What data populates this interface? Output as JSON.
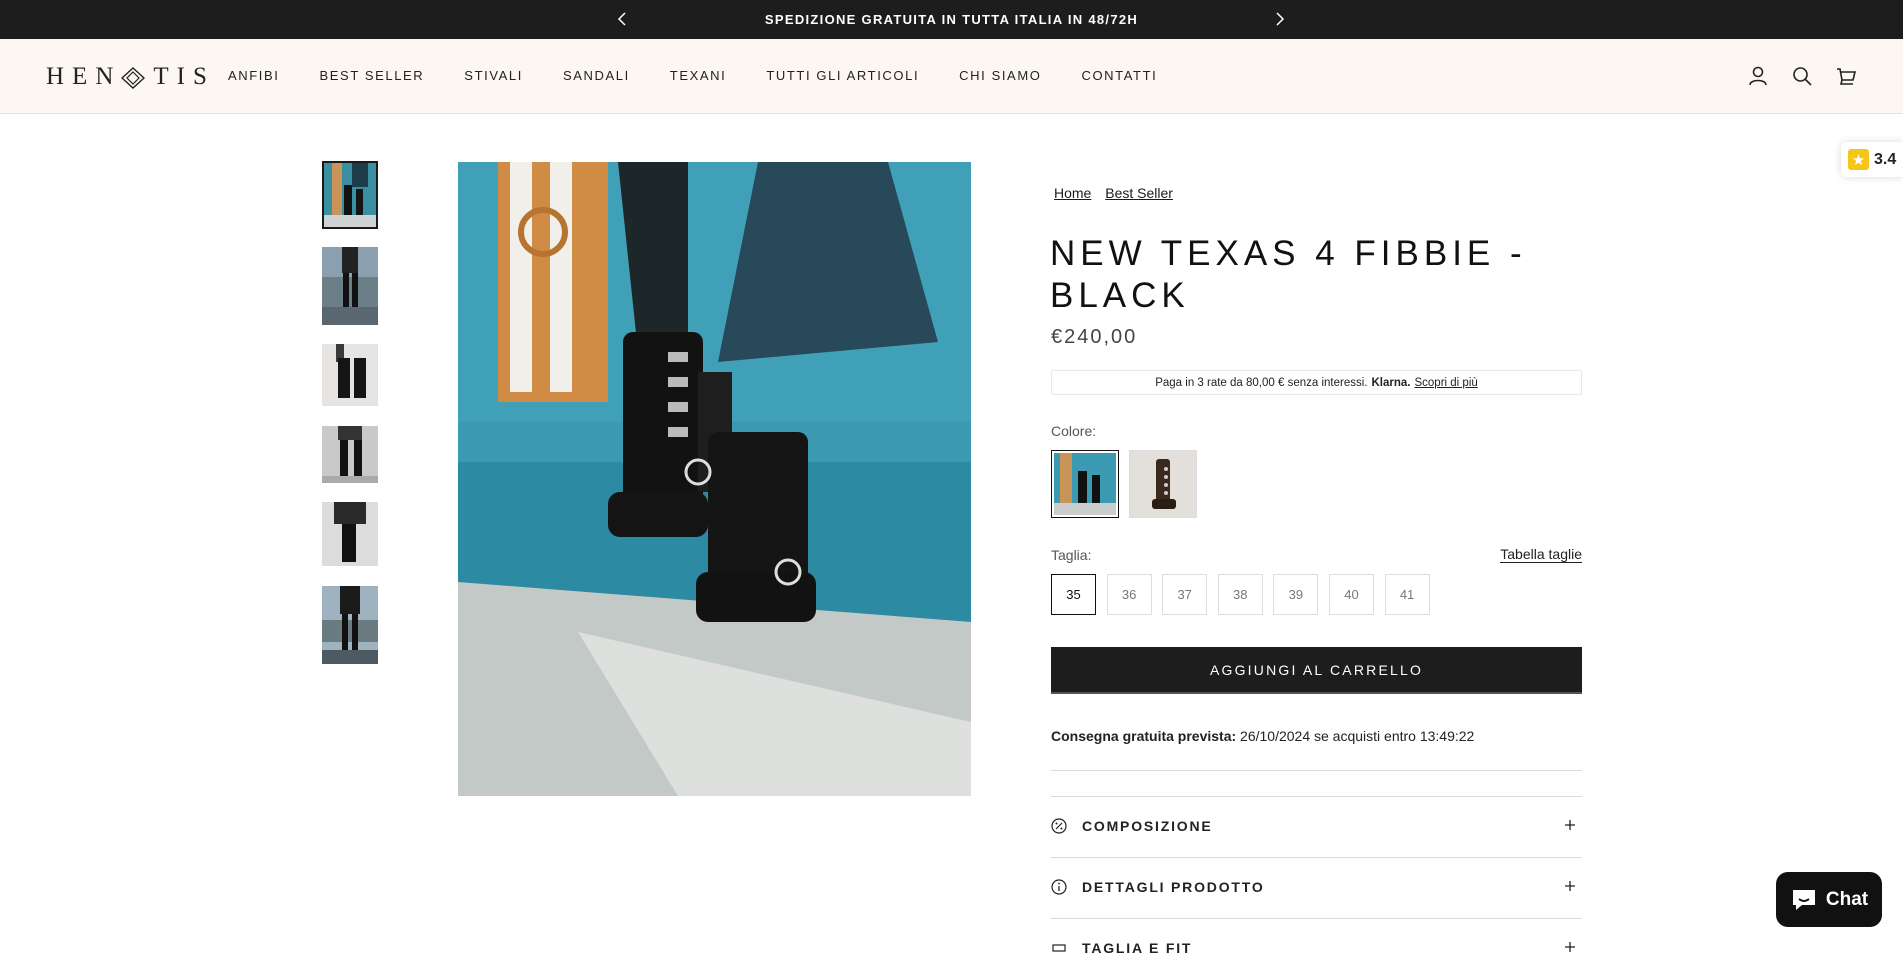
{
  "announcement": {
    "text": "SPEDIZIONE GRATUITA IN TUTTA ITALIA IN 48/72H"
  },
  "header": {
    "logo": "HENOTIS",
    "nav": [
      "ANFIBI",
      "BEST SELLER",
      "STIVALI",
      "SANDALI",
      "TEXANI",
      "TUTTI GLI ARTICOLI",
      "CHI SIAMO",
      "CONTATTI"
    ]
  },
  "rating_badge": {
    "value": "3.4"
  },
  "product": {
    "breadcrumbs": [
      "Home",
      "Best Seller"
    ],
    "title": "NEW TEXAS 4 FIBBIE - BLACK",
    "price": "€240,00",
    "klarna": {
      "text": "Paga in 3 rate da 80,00 € senza interessi.",
      "brand": "Klarna.",
      "link": "Scopri di più"
    },
    "color_label": "Colore:",
    "size_label": "Taglia:",
    "size_chart_link": "Tabella taglie",
    "sizes": [
      "35",
      "36",
      "37",
      "38",
      "39",
      "40",
      "41"
    ],
    "selected_size": "35",
    "add_to_cart": "AGGIUNGI AL CARRELLO",
    "delivery": {
      "label": "Consegna gratuita prevista:",
      "text": "26/10/2024 se acquisti entro 13:49:22"
    },
    "accordions": [
      "COMPOSIZIONE",
      "DETTAGLI PRODOTTO",
      "TAGLIA E FIT"
    ]
  },
  "chat": {
    "label": "Chat"
  },
  "colors": {
    "announcement_bg": "#1d1d1d",
    "header_bg": "#fcf7f0",
    "button_bg": "#1d1d1d",
    "rating_star": "#f5c518"
  }
}
